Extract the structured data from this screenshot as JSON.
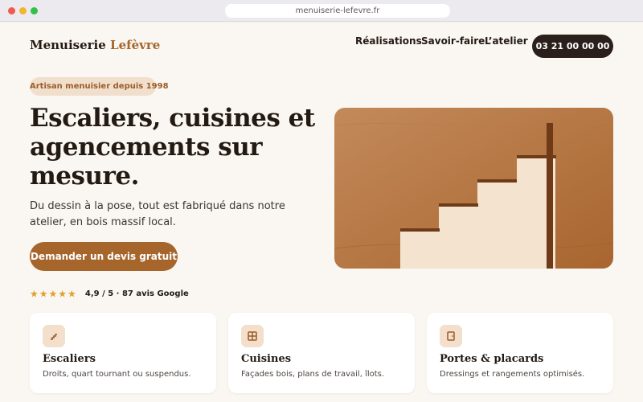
{
  "browser": {
    "url": "menuiserie-lefevre.fr"
  },
  "header": {
    "logo_main": "Menuiserie",
    "logo_accent": "Lefèvre",
    "nav": [
      "Réalisations",
      "Savoir-faire",
      "L’atelier"
    ],
    "phone": "03 21 00 00 00"
  },
  "hero": {
    "badge": "Artisan menuisier depuis 1998",
    "headline": "Escaliers, cuisines et agencements sur mesure.",
    "subhead": "Du dessin à la pose, tout est fabriqué dans notre atelier, en bois massif local.",
    "cta": "Demander un devis gratuit",
    "rating_stars": 5,
    "rating_text": "4,9 / 5 · 87 avis Google"
  },
  "services": [
    {
      "icon": "stairs-icon",
      "title": "Escaliers",
      "description": "Droits, quart tournant ou suspendus."
    },
    {
      "icon": "cabinet-icon",
      "title": "Cuisines",
      "description": "Façades bois, plans de travail, îlots."
    },
    {
      "icon": "door-icon",
      "title": "Portes & placards",
      "description": "Dressings et rangements optimisés."
    }
  ],
  "colors": {
    "accent": "#a5652b",
    "dark": "#2a1f1a",
    "background": "#faf6f1",
    "badge_bg": "#f1dfcd"
  }
}
